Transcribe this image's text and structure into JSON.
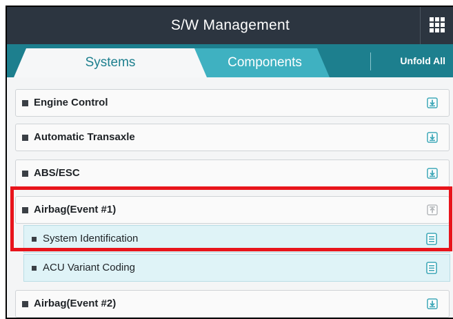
{
  "header": {
    "title": "S/W Management",
    "menu_icon": "grid-icon"
  },
  "tabs": [
    {
      "label": "Systems",
      "active": true
    },
    {
      "label": "Components",
      "active": false
    }
  ],
  "toolbar": {
    "unfold_label": "Unfold All"
  },
  "systems": [
    {
      "label": "Engine Control",
      "icon": "download-icon",
      "expanded": false
    },
    {
      "label": "Automatic Transaxle",
      "icon": "download-icon",
      "expanded": false
    },
    {
      "label": "ABS/ESC",
      "icon": "download-icon",
      "expanded": false
    },
    {
      "label": "Airbag(Event #1)",
      "icon": "upload-icon",
      "expanded": true,
      "children": [
        {
          "label": "System Identification",
          "icon": "document-icon"
        },
        {
          "label": "ACU Variant Coding",
          "icon": "document-icon"
        }
      ]
    },
    {
      "label": "Airbag(Event #2)",
      "icon": "download-icon",
      "expanded": false
    }
  ],
  "colors": {
    "titlebar": "#2c3540",
    "tabbar": "#1d7f8e",
    "active_tab_text": "#1d7f8e",
    "inactive_tab": "#3fb1c1",
    "sub_item_bg": "#dff3f7",
    "highlight": "#e8141b"
  }
}
